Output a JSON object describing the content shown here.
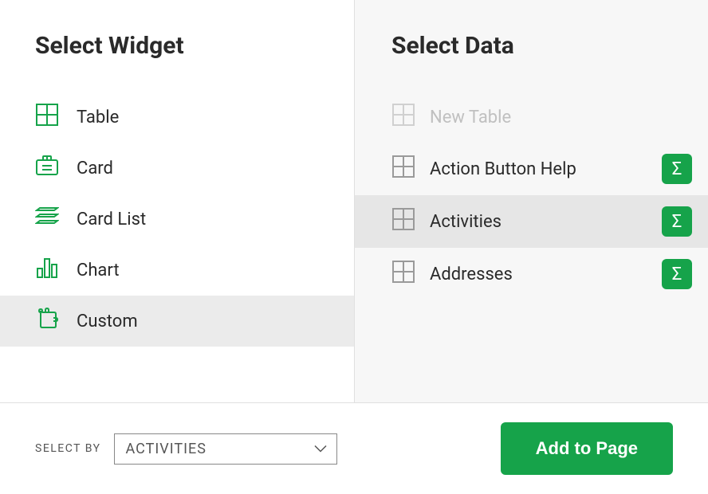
{
  "left": {
    "title": "Select Widget",
    "widgets": [
      {
        "label": "Table"
      },
      {
        "label": "Card"
      },
      {
        "label": "Card List"
      },
      {
        "label": "Chart"
      },
      {
        "label": "Custom"
      }
    ]
  },
  "right": {
    "title": "Select Data",
    "items": [
      {
        "label": "New Table",
        "disabled": true,
        "sigma": false
      },
      {
        "label": "Action Button Help",
        "sigma": true
      },
      {
        "label": "Activities",
        "sigma": true,
        "selected": true
      },
      {
        "label": "Addresses",
        "sigma": true
      }
    ]
  },
  "footer": {
    "select_by_label": "SELECT BY",
    "select_value": "ACTIVITIES",
    "add_label": "Add to Page"
  },
  "selectedWidgetIndex": 4,
  "selectedDataIndex": 2
}
